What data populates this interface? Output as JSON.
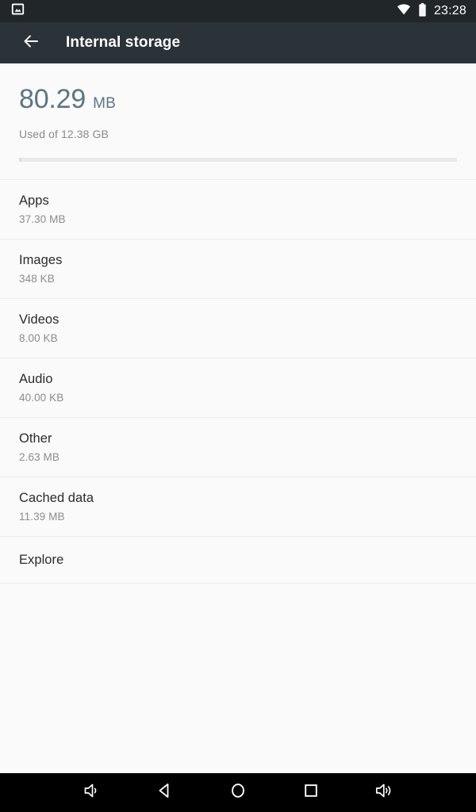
{
  "status_bar": {
    "notification_icon": "image-notification-icon",
    "wifi_icon": "wifi-icon",
    "battery_icon": "battery-icon",
    "clock": "23:28",
    "background_color": "#212629",
    "foreground_color": "#ffffff"
  },
  "toolbar": {
    "back_icon": "arrow-left-icon",
    "title": "Internal storage",
    "background_color": "#2b3238",
    "title_color": "#ffffff"
  },
  "summary": {
    "used_value": "80.29",
    "used_unit": "MB",
    "caption": "Used of 12.38 GB",
    "value_color": "#5c7585",
    "caption_color": "#8a8a8a",
    "progress": {
      "percent": 0.63,
      "track_color": "#e9e9e9",
      "fill_color": "#dcdcdc"
    }
  },
  "storage_items": [
    {
      "label": "Apps",
      "size": "37.30 MB"
    },
    {
      "label": "Images",
      "size": "348 KB"
    },
    {
      "label": "Videos",
      "size": "8.00 KB"
    },
    {
      "label": "Audio",
      "size": "40.00 KB"
    },
    {
      "label": "Other",
      "size": "2.63 MB"
    },
    {
      "label": "Cached data",
      "size": "11.39 MB"
    },
    {
      "label": "Explore",
      "size": ""
    }
  ],
  "nav_bar": {
    "background_color": "#000000",
    "buttons": [
      {
        "name": "volume-down-icon",
        "label": "Volume down"
      },
      {
        "name": "back-icon",
        "label": "Back"
      },
      {
        "name": "home-icon",
        "label": "Home"
      },
      {
        "name": "recents-icon",
        "label": "Recent apps"
      },
      {
        "name": "volume-up-icon",
        "label": "Volume up"
      }
    ]
  },
  "page": {
    "background_color": "#fafafa"
  }
}
